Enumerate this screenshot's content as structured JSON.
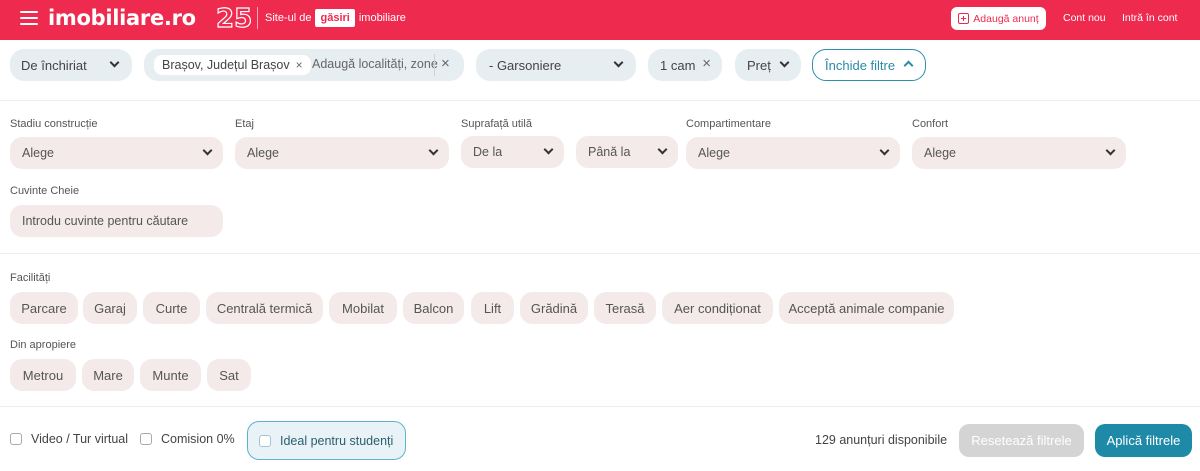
{
  "header": {
    "logo": "imobiliare.ro",
    "anniversary": "25",
    "tagline_before": "Site-ul de",
    "tagline_pill": "găsiri",
    "tagline_after": "imobiliare",
    "add_listing": "Adaugă anunț",
    "new_account": "Cont nou",
    "login": "Intră în cont"
  },
  "filters": {
    "transaction": "De închiriat",
    "location_chip": "Brașov, Județul Brașov",
    "location_placeholder": "Adaugă localități, zone",
    "property_type": "- Garsoniere",
    "rooms": "1 cam",
    "price": "Preț",
    "close_filters": "Închide filtre"
  },
  "advanced": {
    "construction_stage": {
      "label": "Stadiu construcție",
      "value": "Alege"
    },
    "floor": {
      "label": "Etaj",
      "value": "Alege"
    },
    "area": {
      "label": "Suprafață utilă",
      "from": "De la",
      "to": "Până la"
    },
    "partitioning": {
      "label": "Compartimentare",
      "value": "Alege"
    },
    "comfort": {
      "label": "Confort",
      "value": "Alege"
    },
    "keywords": {
      "label": "Cuvinte Cheie",
      "placeholder": "Introdu cuvinte pentru căutare"
    }
  },
  "facilities": {
    "label": "Facilități",
    "items": [
      "Parcare",
      "Garaj",
      "Curte",
      "Centrală termică",
      "Mobilat",
      "Balcon",
      "Lift",
      "Grădină",
      "Terasă",
      "Aer condiționat",
      "Acceptă animale companie"
    ]
  },
  "nearby": {
    "label": "Din apropiere",
    "items": [
      "Metrou",
      "Mare",
      "Munte",
      "Sat"
    ]
  },
  "footer": {
    "video": "Video / Tur virtual",
    "commission": "Comision 0%",
    "students": "Ideal pentru studenți",
    "count": "129 anunțuri disponibile",
    "reset": "Resetează filtrele",
    "apply": "Aplică filtrele"
  },
  "colors": {
    "brand": "#ee2a4f",
    "accent": "#1f8aa8",
    "chip_bg": "#f4eaea",
    "filter_bg": "#e6eef2"
  }
}
